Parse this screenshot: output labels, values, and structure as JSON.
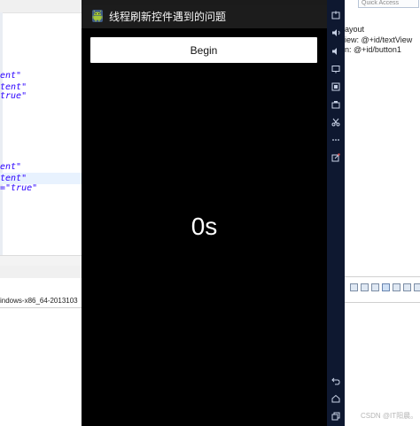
{
  "window": {
    "title": "线程刷新控件遇到的问题"
  },
  "app": {
    "button_label": "Begin",
    "counter_text": "0s"
  },
  "ide_left": {
    "code_lines": [
      {
        "text": "ent\"",
        "highlight": false
      },
      {
        "text": "tent\"",
        "highlight": false
      },
      {
        "text": "true\"",
        "highlight": false
      },
      {
        "text": "ent\"",
        "highlight": false
      },
      {
        "text": "tent\"",
        "highlight": true
      },
      {
        "text": "=\"true\"",
        "highlight": false
      }
    ],
    "console_line": "indows-x86_64-2013103"
  },
  "ide_right": {
    "quick_access": "Quick Access",
    "outline_lines": [
      "ayout",
      "iew: @+id/textView",
      "n: @+id/button1"
    ],
    "watermark": "CSDN @IT阳晨。"
  },
  "emulator_toolbar": {
    "tools": [
      "power-icon",
      "volume-up-icon",
      "volume-down-icon",
      "rotate-icon",
      "screenshot-icon",
      "camera-icon",
      "cut-icon",
      "more-icon",
      "pointer-icon",
      "back-icon",
      "home-icon",
      "overview-icon"
    ]
  },
  "colors": {
    "emulator_background": "#000000",
    "action_bar": "#1c1c1c",
    "toolbar_background": "#0e1830",
    "code_string": "#2a00ff",
    "android_green": "#a4c639"
  }
}
